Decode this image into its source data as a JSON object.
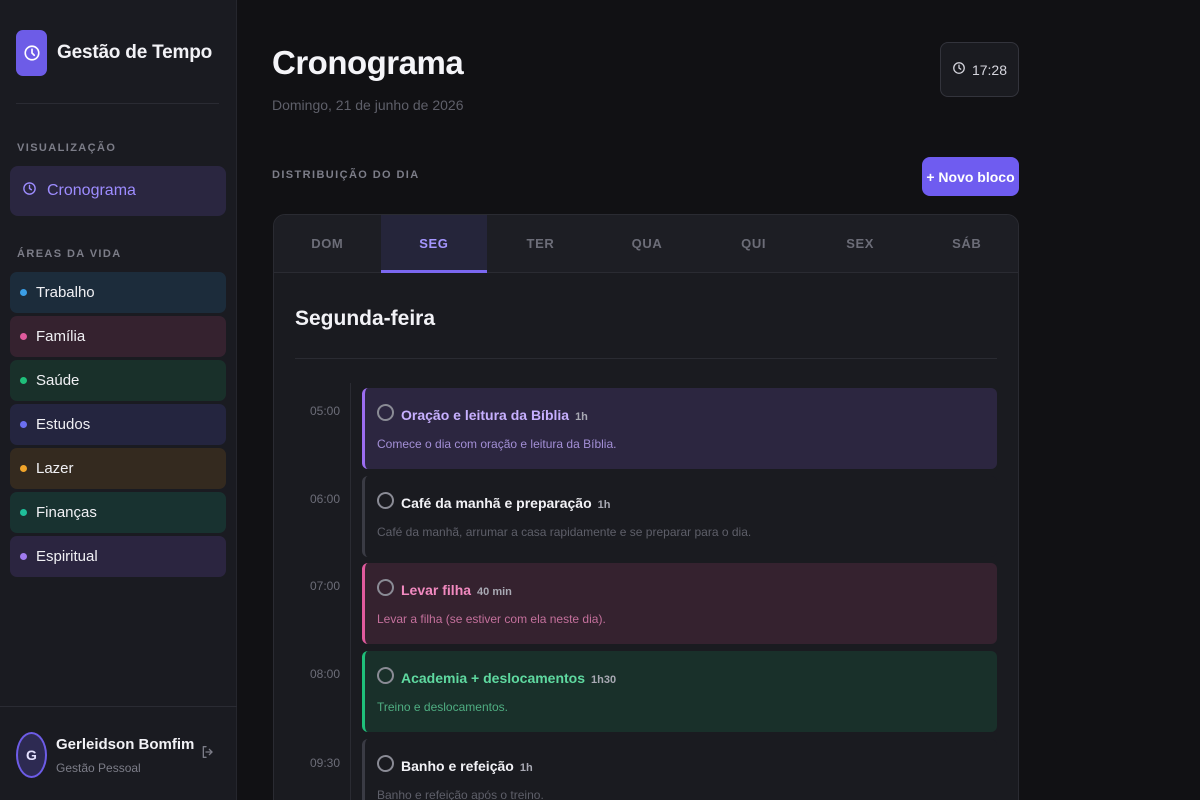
{
  "app": {
    "title": "Gestão de Tempo"
  },
  "sidebar": {
    "visualization_label": "VISUALIZAÇÃO",
    "nav": {
      "label": "Cronograma"
    },
    "areas_label": "ÁREAS DA VIDA",
    "areas": [
      {
        "label": "Trabalho",
        "color": "#3b9ee6",
        "bg": "#1c2c3b"
      },
      {
        "label": "Família",
        "color": "#e05a9d",
        "bg": "#35222f"
      },
      {
        "label": "Saúde",
        "color": "#1fbf7a",
        "bg": "#19302a"
      },
      {
        "label": "Estudos",
        "color": "#6b6ff0",
        "bg": "#24253f"
      },
      {
        "label": "Lazer",
        "color": "#f0a42a",
        "bg": "#342a1f"
      },
      {
        "label": "Finanças",
        "color": "#1fbf9a",
        "bg": "#183230"
      },
      {
        "label": "Espiritual",
        "color": "#a07bf0",
        "bg": "#2b2540"
      }
    ],
    "user": {
      "initial": "G",
      "name": "Gerleidson Bomfim",
      "role": "Gestão Pessoal"
    }
  },
  "header": {
    "title": "Cronograma",
    "date": "Domingo, 21 de junho de 2026",
    "clock": "17:28"
  },
  "schedule": {
    "section_label": "DISTRIBUIÇÃO DO DIA",
    "new_button": "+ Novo bloco",
    "tabs": [
      "DOM",
      "SEG",
      "TER",
      "QUA",
      "QUI",
      "SEX",
      "SÁB"
    ],
    "active_tab": "SEG",
    "day_title": "Segunda-feira",
    "blocks": [
      {
        "time": "05:00",
        "title": "Oração e leitura da Bíblia",
        "duration": "1h",
        "description": "Comece o dia com oração e leitura da Bíblia.",
        "accent": "#9b6df0",
        "bg": "#2c2640",
        "title_color": "#c7b0ff",
        "desc_color": "#a38fd6"
      },
      {
        "time": "06:00",
        "title": "Café da manhã e preparação",
        "duration": "1h",
        "description": "Café da manhã, arrumar a casa rapidamente e se preparar para o dia.",
        "accent": "#3a3b44",
        "bg": "#1a1b20",
        "title_color": "#f2f2f6",
        "desc_color": "#5e5f69"
      },
      {
        "time": "07:00",
        "title": "Levar filha",
        "duration": "40 min",
        "description": "Levar a filha (se estiver com ela neste dia).",
        "accent": "#e05a9d",
        "bg": "#35222f",
        "title_color": "#f28ac0",
        "desc_color": "#c4709c"
      },
      {
        "time": "08:00",
        "title": "Academia + deslocamentos",
        "duration": "1h30",
        "description": "Treino e deslocamentos.",
        "accent": "#1fbf7a",
        "bg": "#19302a",
        "title_color": "#5fd9a0",
        "desc_color": "#4fae82"
      },
      {
        "time": "09:30",
        "title": "Banho e refeição",
        "duration": "1h",
        "description": "Banho e refeição após o treino.",
        "accent": "#3a3b44",
        "bg": "#1a1b20",
        "title_color": "#f2f2f6",
        "desc_color": "#5e5f69"
      }
    ]
  }
}
